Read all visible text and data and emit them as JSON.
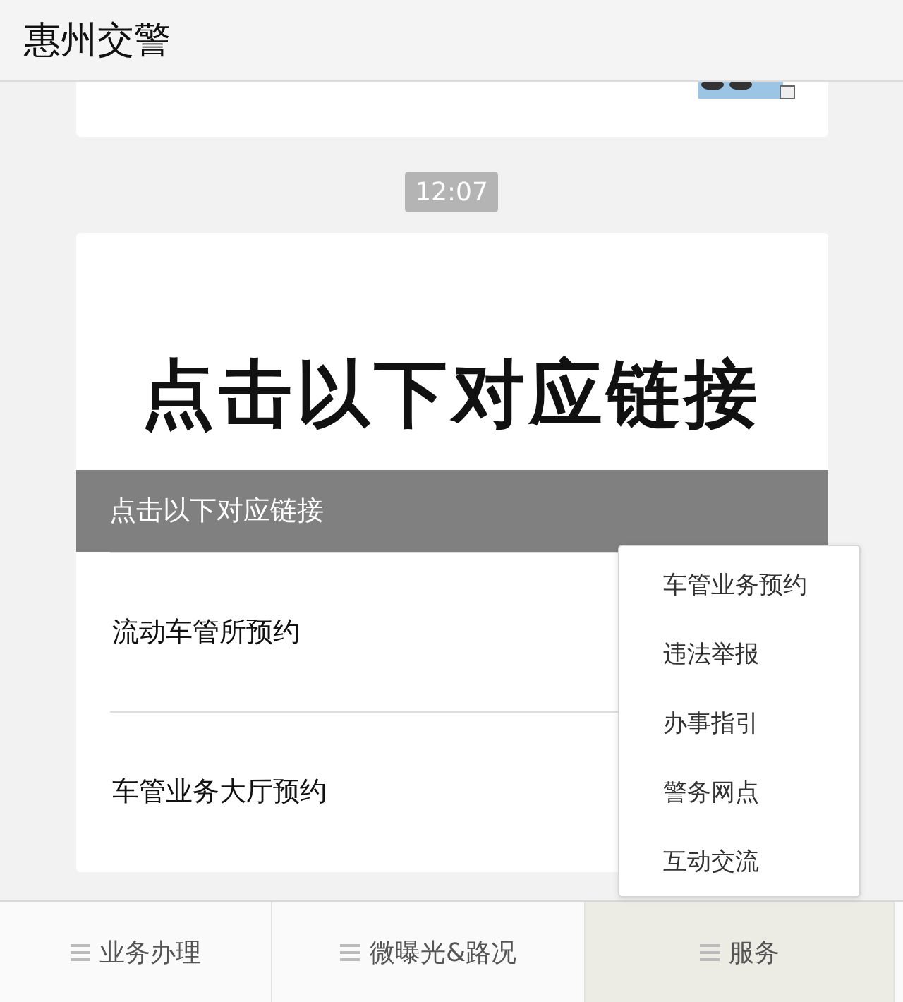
{
  "header": {
    "title": "惠州交警"
  },
  "timestamp": "12:07",
  "article": {
    "banner": "点击以下对应链接",
    "caption": "点击以下对应链接",
    "links": [
      "流动车管所预约",
      "车管业务大厅预约"
    ]
  },
  "popup_menu": {
    "items": [
      "车管业务预约",
      "违法举报",
      "办事指引",
      "警务网点",
      "互动交流"
    ]
  },
  "bottom_nav": [
    {
      "label": "业务办理",
      "selected": false
    },
    {
      "label": "微曝光&路况",
      "selected": false
    },
    {
      "label": "服务",
      "selected": true
    }
  ]
}
